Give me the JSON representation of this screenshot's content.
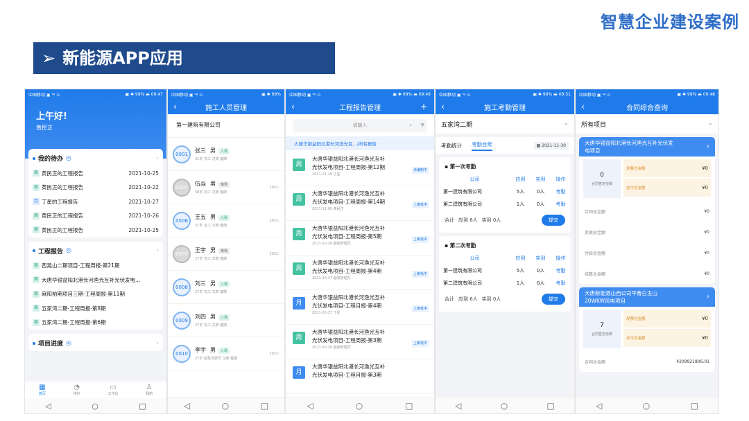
{
  "brand": "智慧企业建设案例",
  "banner": {
    "arrow": "➢",
    "title": "新能源APP应用"
  },
  "phone1": {
    "status_left": "中国移动 ▣ ⁴ᵍ ⊙",
    "status_right": "▣ ✱ 99% ▬ 09:47",
    "greeting": "上午好!",
    "user": "黄民正",
    "todo_title": "我的待办",
    "todo": [
      {
        "tag": "周",
        "text": "黄民正的工程报告",
        "date": "2021-10-25"
      },
      {
        "tag": "周",
        "text": "黄民正的工程报告",
        "date": "2021-10-22"
      },
      {
        "tag": "月",
        "text": "丁星的工程报告",
        "date": "2021-10-27"
      },
      {
        "tag": "周",
        "text": "黄民正的工程报告",
        "date": "2021-10-26"
      },
      {
        "tag": "周",
        "text": "黄民正的工程报告",
        "date": "2021-10-25"
      }
    ],
    "report_title": "工程报告",
    "reports": [
      {
        "tag": "周",
        "text": "西晃山二期项目-工程周报-第21期"
      },
      {
        "tag": "周",
        "text": "大唐华银益阳北港长河渔光互补光伏发电..."
      },
      {
        "tag": "周",
        "text": "麻阳前期项目三期-工程周报-第11期"
      },
      {
        "tag": "周",
        "text": "五家湾二期-工程周报-第8期"
      },
      {
        "tag": "周",
        "text": "五家湾二期-工程周报-第6期"
      }
    ],
    "progress_title": "项目进度",
    "nav": [
      {
        "icon": "▦",
        "label": "首页"
      },
      {
        "icon": "◔",
        "label": "待办"
      },
      {
        "icon": "▭",
        "label": "工作台"
      },
      {
        "icon": "♙",
        "label": "我的"
      }
    ]
  },
  "phone2": {
    "status_left": "中国移动 ▣ ⁴ᵍ ⊙",
    "status_right": "▣ ✱ 99%",
    "title": "施工人员管理",
    "company": "第一建筑有限公司",
    "people": [
      {
        "id": "0001",
        "name": "张三",
        "gender": "男",
        "badge": "入场",
        "sub": "31岁   瓦工   汉族   健康",
        "date": ""
      },
      {
        "id": "0004",
        "name": "伍焱",
        "gender": "男",
        "badge": "离场",
        "sub": "38岁   瓦工   汉族   健康",
        "date": "2021-"
      },
      {
        "id": "0006",
        "name": "王五",
        "gender": "男",
        "badge": "入场",
        "sub": "31岁   瓦工   汉族   健康",
        "date": "2021-"
      },
      {
        "id": "0007",
        "name": "王宇",
        "gender": "男",
        "badge": "离场",
        "sub": "27岁   瓦工   汉族   健康",
        "date": "2021-"
      },
      {
        "id": "0008",
        "name": "刘三",
        "gender": "男",
        "badge": "入场",
        "sub": "27岁   瓦工   汉族   健康",
        "date": ""
      },
      {
        "id": "0009",
        "name": "刘四",
        "gender": "男",
        "badge": "入场",
        "sub": "27岁   瓦工   汉族   健康",
        "date": ""
      },
      {
        "id": "0010",
        "name": "李宇",
        "gender": "男",
        "badge": "入场",
        "sub": "27岁   起机驾驶员   汉族   健康",
        "date": "2021-"
      }
    ]
  },
  "phone3": {
    "status_left": "中国移动 ▣ ⁴ᵍ ⊙",
    "status_right": "▣ ✱ 99% ▬ 09:49",
    "title": "工程报告管理",
    "search_placeholder": "请输入",
    "note": "大唐华银益阳北港长河渔光互.../所有报告",
    "reports": [
      {
        "tag": "周",
        "l1": "大唐华银益阳北港长河渔光互补",
        "l2": "光伏发电项目-工程周报-第12期",
        "sub": "2021-11-26 丁星",
        "st": "未编制中"
      },
      {
        "tag": "周",
        "l1": "大唐华银益阳北港长河渔光互补",
        "l2": "光伏发电项目-工程周报-第14期",
        "sub": "2021-11-09 黄民正",
        "st": "上审批中"
      },
      {
        "tag": "周",
        "l1": "大唐华银益阳北港长河渔光互补",
        "l2": "光伏发电项目-工程周报-第5期",
        "sub": "2021-10-26 超级管理员",
        "st": "上审批中"
      },
      {
        "tag": "周",
        "l1": "大唐华银益阳北港长河渔光互补",
        "l2": "光伏发电项目-工程周报-第4期",
        "sub": "2021-10-27 超级管理员",
        "st": "上审批中"
      },
      {
        "tag": "月",
        "l1": "大唐华银益阳北港长河渔光互补",
        "l2": "光伏发电项目-工程月报-第4期",
        "sub": "2021-10-27 丁星",
        "st": "上审批中"
      },
      {
        "tag": "周",
        "l1": "大唐华银益阳北港长河渔光互补",
        "l2": "光伏发电项目-工程周报-第3期",
        "sub": "2021-10-26 超级管理员",
        "st": "上审批中"
      },
      {
        "tag": "月",
        "l1": "大唐华银益阳北港长河渔光互补",
        "l2": "光伏发电项目-工程月报-第3期",
        "sub": "",
        "st": ""
      }
    ]
  },
  "phone4": {
    "status_left": "中国移动 ▣ ⁴ᵍ ⊙",
    "status_right": "▣ ✱ 99% ▬ 09:51",
    "title": "施工考勤管理",
    "project": "五家湾二期",
    "tab1": "考勤统计",
    "tab2": "考勤台账",
    "date": "2021-11-30",
    "cols": [
      "公司",
      "应到",
      "实到",
      "操作"
    ],
    "groups": [
      {
        "title": "第一次考勤",
        "rows": [
          {
            "c": "第一建筑有限公司",
            "a": "5人",
            "b": "0人",
            "op": "考勤"
          },
          {
            "c": "第二建筑有限公司",
            "a": "1人",
            "b": "0人",
            "op": "考勤"
          }
        ],
        "sum": "合计",
        "due": "应到 6人",
        "act": "实到 0人",
        "btn": "提交"
      },
      {
        "title": "第二次考勤",
        "rows": [
          {
            "c": "第一建筑有限公司",
            "a": "5人",
            "b": "0人",
            "op": "考勤"
          },
          {
            "c": "第二建筑有限公司",
            "a": "1人",
            "b": "0人",
            "op": "考勤"
          }
        ],
        "sum": "合计",
        "due": "应到 6人",
        "act": "实到 0人",
        "btn": "提交"
      }
    ]
  },
  "phone5": {
    "status_left": "中国移动 ▣ ⁴ᵍ ⊙",
    "status_right": "▣ ✱ 99% ▬ 09:48",
    "title": "合同综合查询",
    "filter": "所有项目",
    "c1": {
      "t1": "大唐华银益阳北港长河渔光互补光伏发",
      "t2": "电项目",
      "num": "0",
      "numlabel": "合同签定份数",
      "r1": "发票总金额",
      "v1": "¥0",
      "r2": "支付总金额",
      "v2": "¥0",
      "lines": [
        {
          "k": "合同总金额",
          "v": "¥0"
        },
        {
          "k": "变更总金额",
          "v": "¥0"
        },
        {
          "k": "付款总金额",
          "v": "¥0"
        },
        {
          "k": "结算总金额",
          "v": "¥0"
        }
      ]
    },
    "c2": {
      "t1": "大唐新能源山西公司平鲁白玉山",
      "t2": "20WKW风电项目",
      "num": "7",
      "numlabel": "合同签定份数",
      "r1": "发票总金额",
      "v1": "¥0",
      "r2": "支付总金额",
      "v2": "¥0",
      "lines": [
        {
          "k": "合同总金额",
          "v": "¥209921806.01"
        }
      ]
    }
  },
  "android": {
    "back": "◁",
    "home": "○",
    "recent": "□"
  }
}
